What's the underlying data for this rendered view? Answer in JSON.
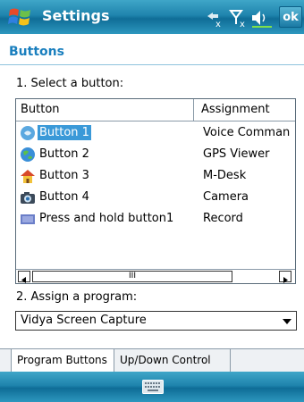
{
  "window": {
    "title": "Settings",
    "ok_label": "ok"
  },
  "page": {
    "heading": "Buttons",
    "select_label": "1. Select a button:",
    "assign_label": "2. Assign a program:"
  },
  "list": {
    "columns": [
      "Button",
      "Assignment"
    ],
    "rows": [
      {
        "name": "Button 1",
        "assignment": "Voice Comman",
        "icon": "voice-command-icon",
        "selected": true
      },
      {
        "name": "Button 2",
        "assignment": "GPS Viewer",
        "icon": "gps-globe-icon",
        "selected": false
      },
      {
        "name": "Button 3",
        "assignment": "M-Desk",
        "icon": "home-icon",
        "selected": false
      },
      {
        "name": "Button 4",
        "assignment": "Camera",
        "icon": "camera-icon",
        "selected": false
      },
      {
        "name": "Press and hold button1",
        "assignment": "Record",
        "icon": "record-icon",
        "selected": false
      }
    ],
    "scroll_thumb_label": "III"
  },
  "program_select": {
    "value": "Vidya Screen Capture"
  },
  "tabs": [
    {
      "label": "Program Buttons",
      "active": true
    },
    {
      "label": "Up/Down Control",
      "active": false
    }
  ],
  "colors": {
    "accent": "#1a7fbe",
    "selection": "#3a99d8",
    "bar": "#1f84ad"
  }
}
